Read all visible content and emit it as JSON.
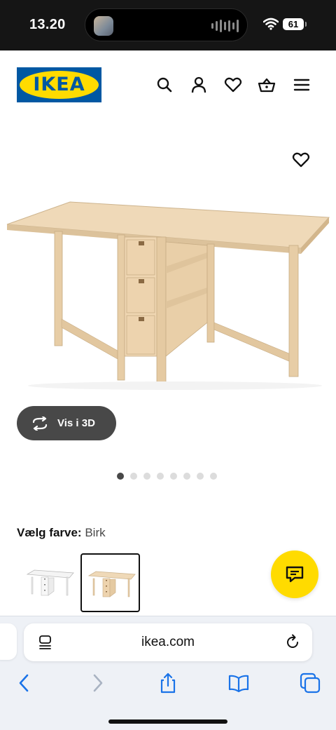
{
  "status_bar": {
    "time": "13.20",
    "battery": "61"
  },
  "header": {
    "logo_text": "IKEA"
  },
  "product": {
    "view_3d_label": "Vis i 3D",
    "image_count": 8,
    "active_image": 1
  },
  "color_selector": {
    "label": "Vælg farve:",
    "value": "Birk",
    "options": [
      "Hvid",
      "Birk"
    ],
    "selected": "Birk"
  },
  "browser": {
    "url": "ikea.com"
  },
  "colors": {
    "ikea_blue": "#0058a3",
    "ikea_yellow": "#ffdb00",
    "button_dark": "#484848",
    "wood": "#ead2ae"
  }
}
